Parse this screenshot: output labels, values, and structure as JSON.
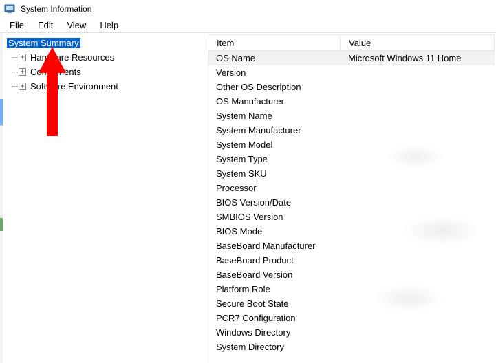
{
  "window": {
    "title": "System Information"
  },
  "menubar": [
    "File",
    "Edit",
    "View",
    "Help"
  ],
  "tree": {
    "root": "System Summary",
    "children": [
      "Hardware Resources",
      "Components",
      "Software Environment"
    ]
  },
  "columns": {
    "item": "Item",
    "value": "Value"
  },
  "rows": [
    {
      "item": "OS Name",
      "value": "Microsoft Windows 11 Home",
      "selected": true
    },
    {
      "item": "Version",
      "value": ""
    },
    {
      "item": "Other OS Description",
      "value": ""
    },
    {
      "item": "OS Manufacturer",
      "value": ""
    },
    {
      "item": "System Name",
      "value": ""
    },
    {
      "item": "System Manufacturer",
      "value": ""
    },
    {
      "item": "System Model",
      "value": ""
    },
    {
      "item": "System Type",
      "value": ""
    },
    {
      "item": "System SKU",
      "value": ""
    },
    {
      "item": "Processor",
      "value": ""
    },
    {
      "item": "BIOS Version/Date",
      "value": ""
    },
    {
      "item": "SMBIOS Version",
      "value": ""
    },
    {
      "item": "BIOS Mode",
      "value": ""
    },
    {
      "item": "BaseBoard Manufacturer",
      "value": ""
    },
    {
      "item": "BaseBoard Product",
      "value": ""
    },
    {
      "item": "BaseBoard Version",
      "value": ""
    },
    {
      "item": "Platform Role",
      "value": ""
    },
    {
      "item": "Secure Boot State",
      "value": ""
    },
    {
      "item": "PCR7 Configuration",
      "value": ""
    },
    {
      "item": "Windows Directory",
      "value": ""
    },
    {
      "item": "System Directory",
      "value": ""
    }
  ],
  "annotation": {
    "arrow_color": "#ff0000"
  }
}
